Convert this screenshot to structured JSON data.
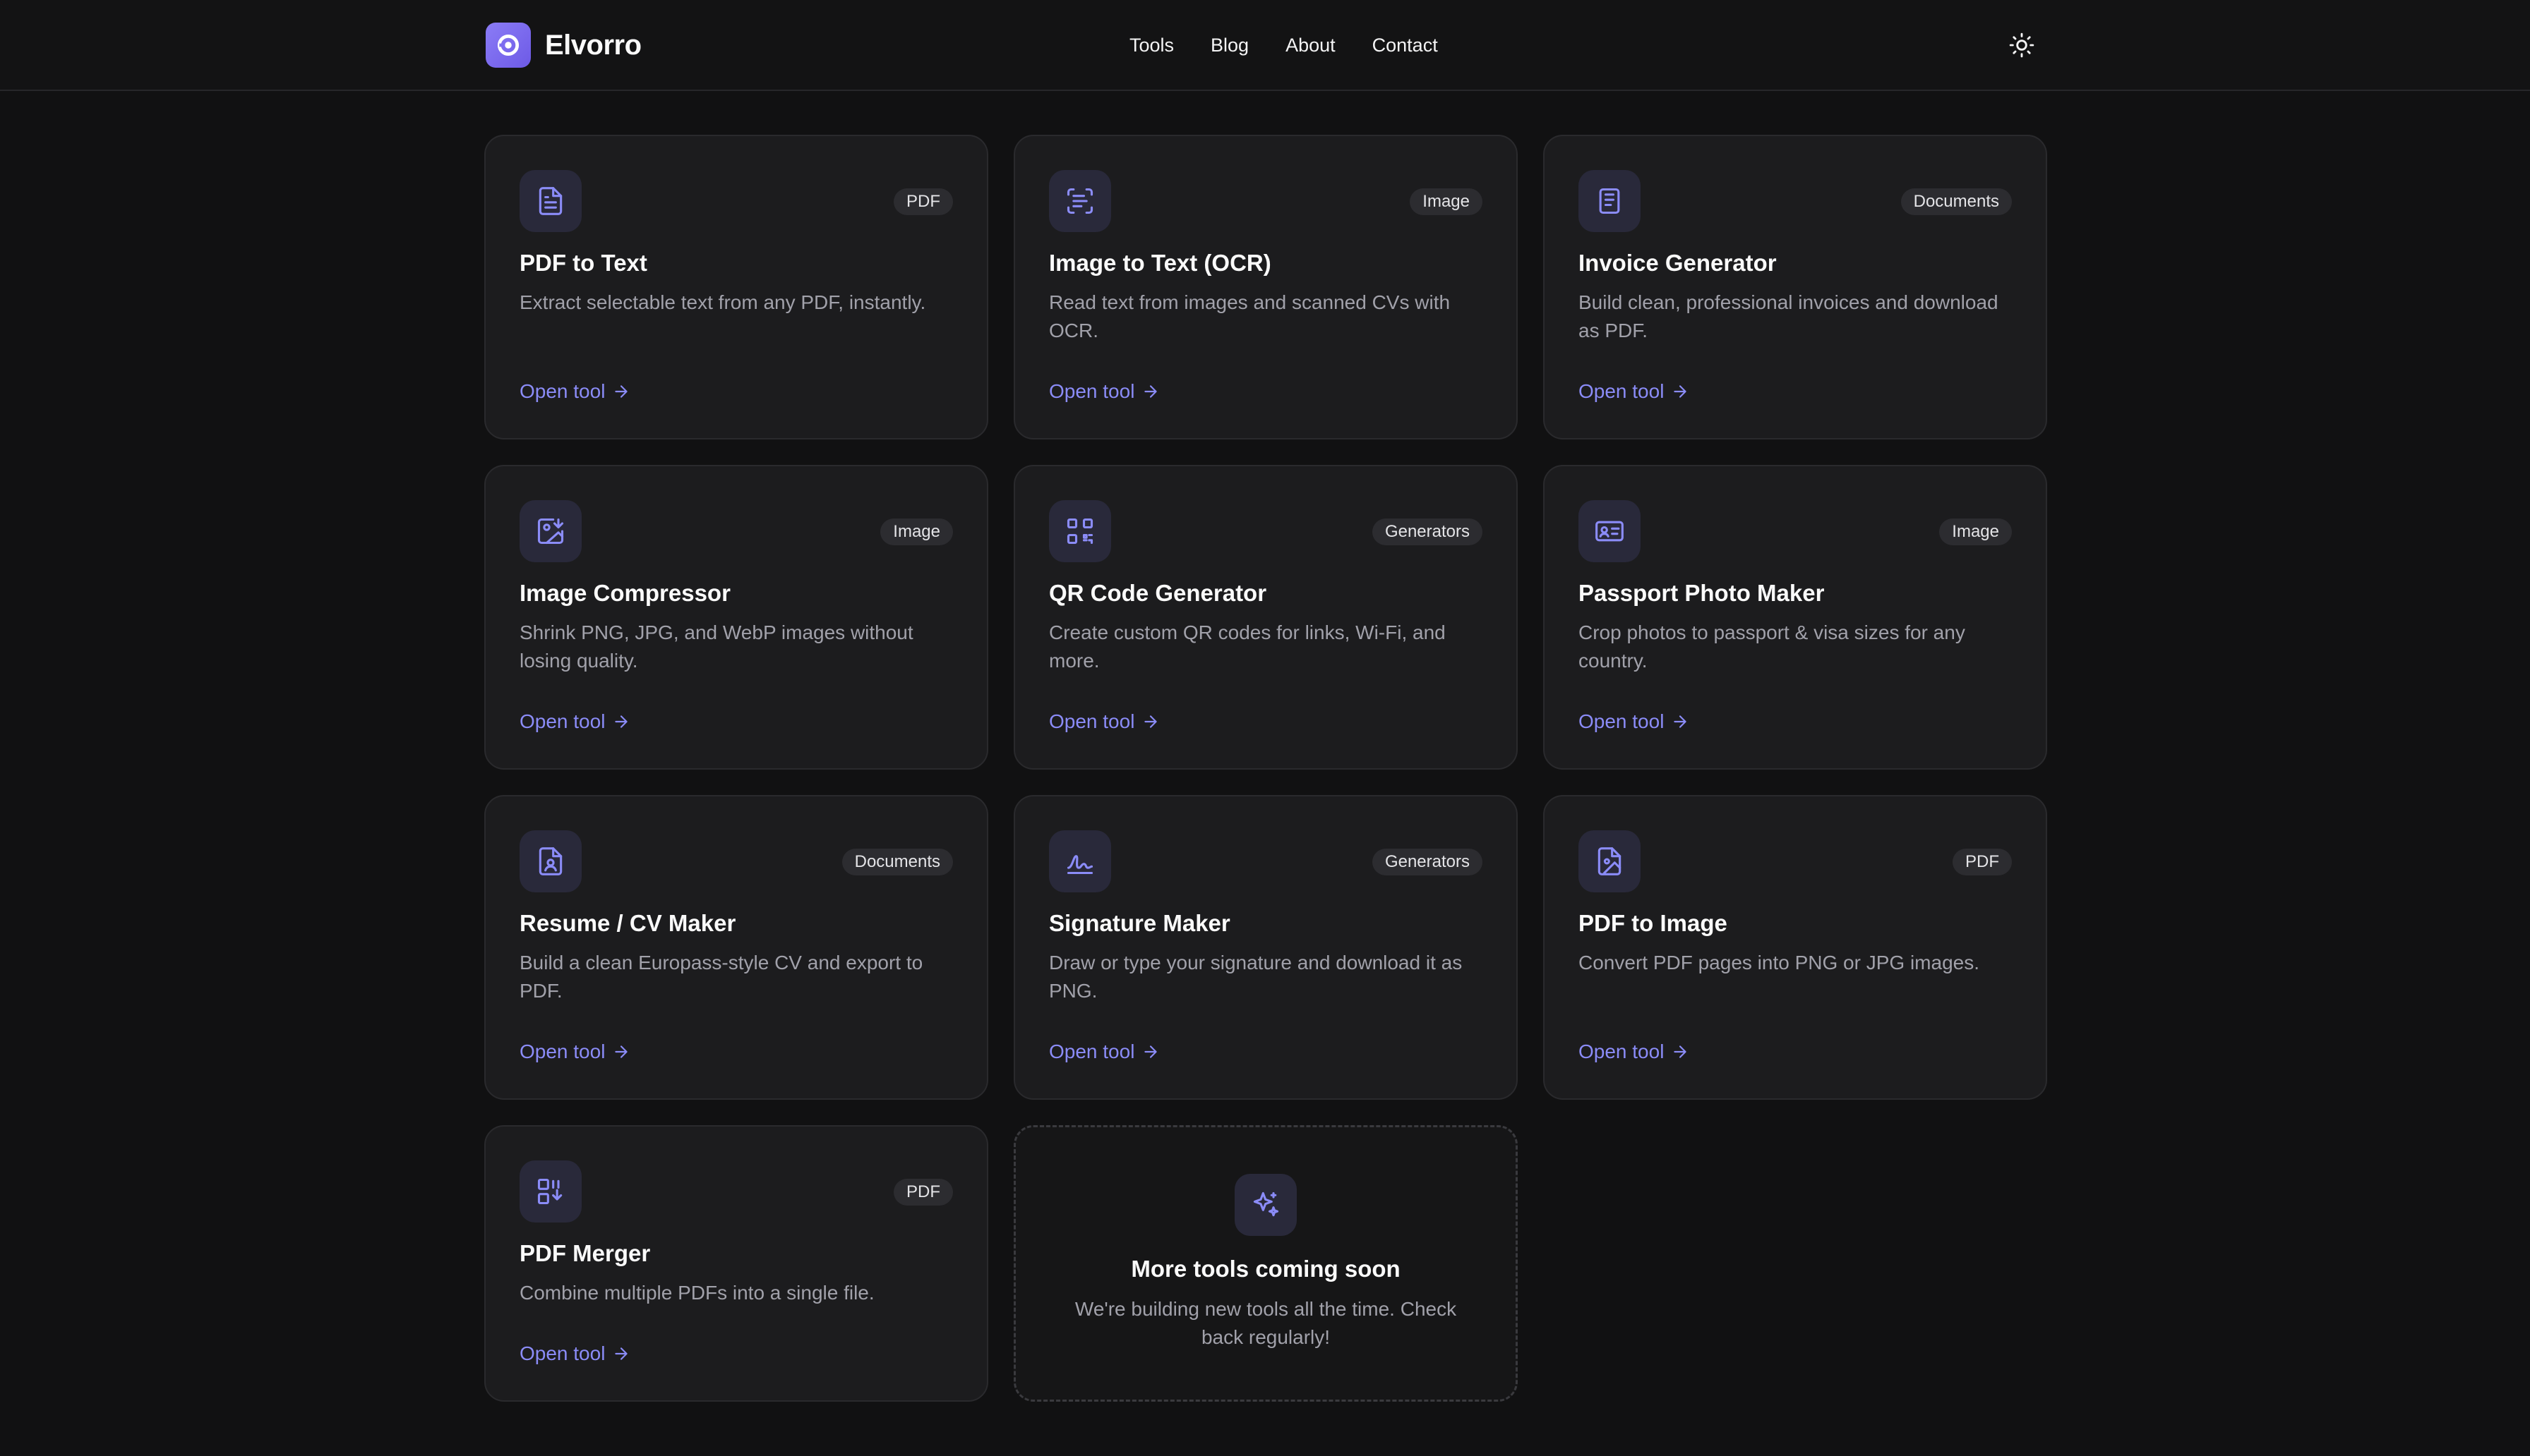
{
  "brand": {
    "name": "Elvorro"
  },
  "nav": [
    {
      "label": "Tools"
    },
    {
      "label": "Blog"
    },
    {
      "label": "About"
    },
    {
      "label": "Contact"
    }
  ],
  "colors": {
    "accent": "#8b8cf8",
    "background": "#111112",
    "card": "#1c1c1e"
  },
  "tools": [
    {
      "icon": "file-text-icon",
      "badge": "PDF",
      "title": "PDF to Text",
      "description": "Extract selectable text from any PDF, instantly.",
      "link": "Open tool"
    },
    {
      "icon": "scan-text-icon",
      "badge": "Image",
      "title": "Image to Text (OCR)",
      "description": "Read text from images and scanned CVs with OCR.",
      "link": "Open tool"
    },
    {
      "icon": "receipt-icon",
      "badge": "Documents",
      "title": "Invoice Generator",
      "description": "Build clean, professional invoices and download as PDF.",
      "link": "Open tool"
    },
    {
      "icon": "image-down-icon",
      "badge": "Image",
      "title": "Image Compressor",
      "description": "Shrink PNG, JPG, and WebP images without losing quality.",
      "link": "Open tool"
    },
    {
      "icon": "qr-code-icon",
      "badge": "Generators",
      "title": "QR Code Generator",
      "description": "Create custom QR codes for links, Wi-Fi, and more.",
      "link": "Open tool"
    },
    {
      "icon": "id-card-icon",
      "badge": "Image",
      "title": "Passport Photo Maker",
      "description": "Crop photos to passport & visa sizes for any country.",
      "link": "Open tool"
    },
    {
      "icon": "file-user-icon",
      "badge": "Documents",
      "title": "Resume / CV Maker",
      "description": "Build a clean Europass-style CV and export to PDF.",
      "link": "Open tool"
    },
    {
      "icon": "signature-icon",
      "badge": "Generators",
      "title": "Signature Maker",
      "description": "Draw or type your signature and download it as PNG.",
      "link": "Open tool"
    },
    {
      "icon": "file-image-icon",
      "badge": "PDF",
      "title": "PDF to Image",
      "description": "Convert PDF pages into PNG or JPG images.",
      "link": "Open tool"
    },
    {
      "icon": "merge-icon",
      "badge": "PDF",
      "title": "PDF Merger",
      "description": "Combine multiple PDFs into a single file.",
      "link": "Open tool"
    }
  ],
  "coming_soon": {
    "icon": "sparkles-icon",
    "title": "More tools coming soon",
    "description": "We're building new tools all the time. Check back regularly!"
  }
}
